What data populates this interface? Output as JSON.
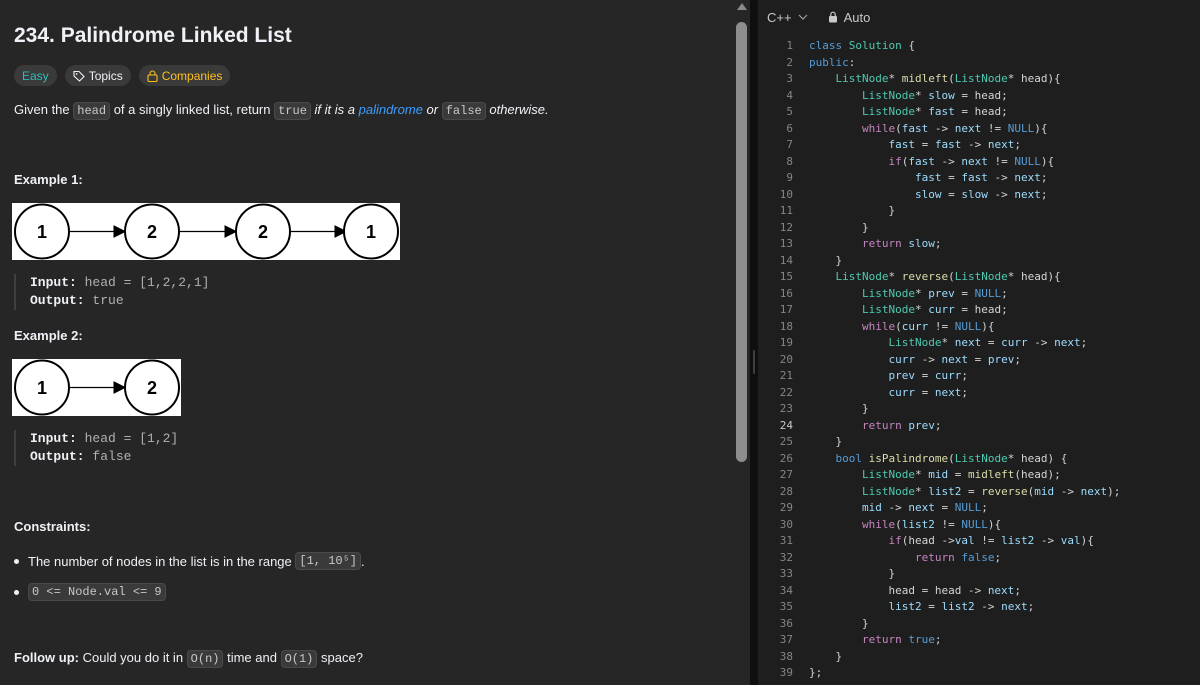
{
  "problem": {
    "title": "234. Palindrome Linked List",
    "tags": {
      "difficulty": "Easy",
      "topics": "Topics",
      "companies": "Companies"
    },
    "description": {
      "p1": "Given the ",
      "c1": "head",
      "p2": " of a singly linked list, return ",
      "c2": "true",
      "p3": " if it is a ",
      "link": "palindrome",
      "p4": " or ",
      "c3": "false",
      "p5": " otherwise."
    },
    "examples": [
      {
        "heading": "Example 1:",
        "nodes": [
          "1",
          "2",
          "2",
          "1"
        ],
        "input_label": "Input:",
        "input_value": " head = [1,2,2,1]",
        "output_label": "Output:",
        "output_value": " true"
      },
      {
        "heading": "Example 2:",
        "nodes": [
          "1",
          "2"
        ],
        "input_label": "Input:",
        "input_value": " head = [1,2]",
        "output_label": "Output:",
        "output_value": " false"
      }
    ],
    "constraints": {
      "heading": "Constraints:",
      "items": [
        {
          "pre": "The number of nodes in the list is in the range ",
          "code": "[1, 10⁵]",
          "post": "."
        },
        {
          "pre": "",
          "code": "0 <= Node.val <= 9",
          "post": ""
        }
      ]
    },
    "follow_up": {
      "label": "Follow up:",
      "p1": " Could you do it in ",
      "c1": "O(n)",
      "p2": " time and ",
      "c2": "O(1)",
      "p3": " space?"
    }
  },
  "editor": {
    "language": "C++",
    "mode": "Auto",
    "current_line": 24,
    "lines": [
      "class Solution {",
      "public:",
      "    ListNode* midleft(ListNode* head){",
      "        ListNode* slow = head;",
      "        ListNode* fast = head;",
      "        while(fast -> next != NULL){",
      "            fast = fast -> next;",
      "            if(fast -> next != NULL){",
      "                fast = fast -> next;",
      "                slow = slow -> next;",
      "            }",
      "        }",
      "        return slow;",
      "    }",
      "    ListNode* reverse(ListNode* head){",
      "        ListNode* prev = NULL;",
      "        ListNode* curr = head;",
      "        while(curr != NULL){",
      "            ListNode* next = curr -> next;",
      "            curr -> next = prev;",
      "            prev = curr;",
      "            curr = next;",
      "        }",
      "        return prev;",
      "    }",
      "    bool isPalindrome(ListNode* head) {",
      "        ListNode* mid = midleft(head);",
      "        ListNode* list2 = reverse(mid -> next);",
      "        mid -> next = NULL;",
      "        while(list2 != NULL){",
      "            if(head ->val != list2 -> val){",
      "                return false;",
      "            }",
      "            head = head -> next;",
      "            list2 = list2 -> next;",
      "        }",
      "        return true;",
      "    }",
      "};"
    ]
  },
  "colors": {
    "easy": "#2cbbba",
    "companies": "#ffc01e",
    "link": "#3a9eff",
    "editor_bg": "#1e1e1e",
    "panel_bg": "#262626"
  }
}
